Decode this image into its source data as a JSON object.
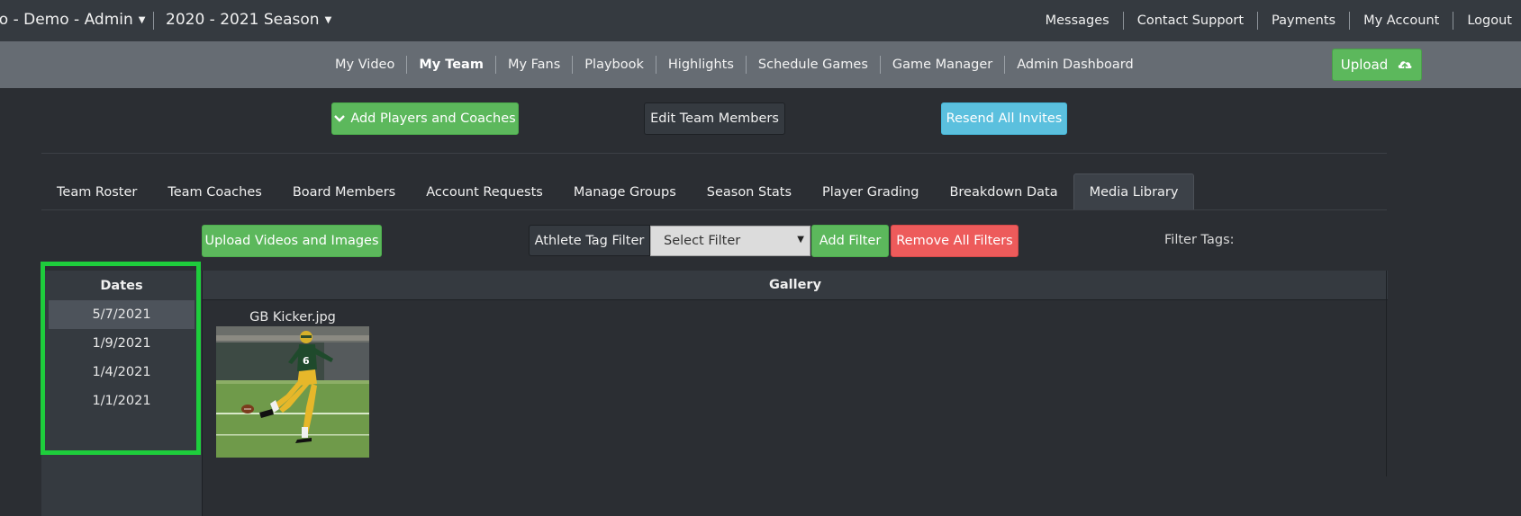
{
  "topbar": {
    "org_label": "ho - Demo - Admin",
    "season_label": "2020 - 2021 Season",
    "links": [
      "Messages",
      "Contact Support",
      "Payments",
      "My Account",
      "Logout"
    ]
  },
  "nav": {
    "links": [
      "My Video",
      "My Team",
      "My Fans",
      "Playbook",
      "Highlights",
      "Schedule Games",
      "Game Manager",
      "Admin Dashboard"
    ],
    "active": "My Team",
    "upload_label": "Upload"
  },
  "actions": {
    "add_players_label": "Add Players and Coaches",
    "edit_members_label": "Edit Team Members",
    "resend_invites_label": "Resend All Invites"
  },
  "tabs": {
    "items": [
      "Team Roster",
      "Team Coaches",
      "Board Members",
      "Account Requests",
      "Manage Groups",
      "Season Stats",
      "Player Grading",
      "Breakdown Data",
      "Media Library"
    ],
    "active": "Media Library"
  },
  "filters": {
    "upload_media_label": "Upload Videos and Images",
    "athlete_tag_filter_label": "Athlete Tag Filter",
    "select_value": "Select Filter",
    "add_filter_label": "Add Filter",
    "remove_filters_label": "Remove All Filters",
    "filter_tags_label": "Filter Tags:"
  },
  "dates": {
    "header": "Dates",
    "items": [
      "5/7/2021",
      "1/9/2021",
      "1/4/2021",
      "1/1/2021"
    ],
    "selected": "5/7/2021"
  },
  "gallery": {
    "header": "Gallery",
    "items": [
      {
        "name": "GB Kicker.jpg"
      }
    ]
  },
  "colors": {
    "highlight": "#1ecd3c",
    "green": "#5cb85c",
    "blue": "#5bc0de",
    "red": "#ed5b5b"
  }
}
